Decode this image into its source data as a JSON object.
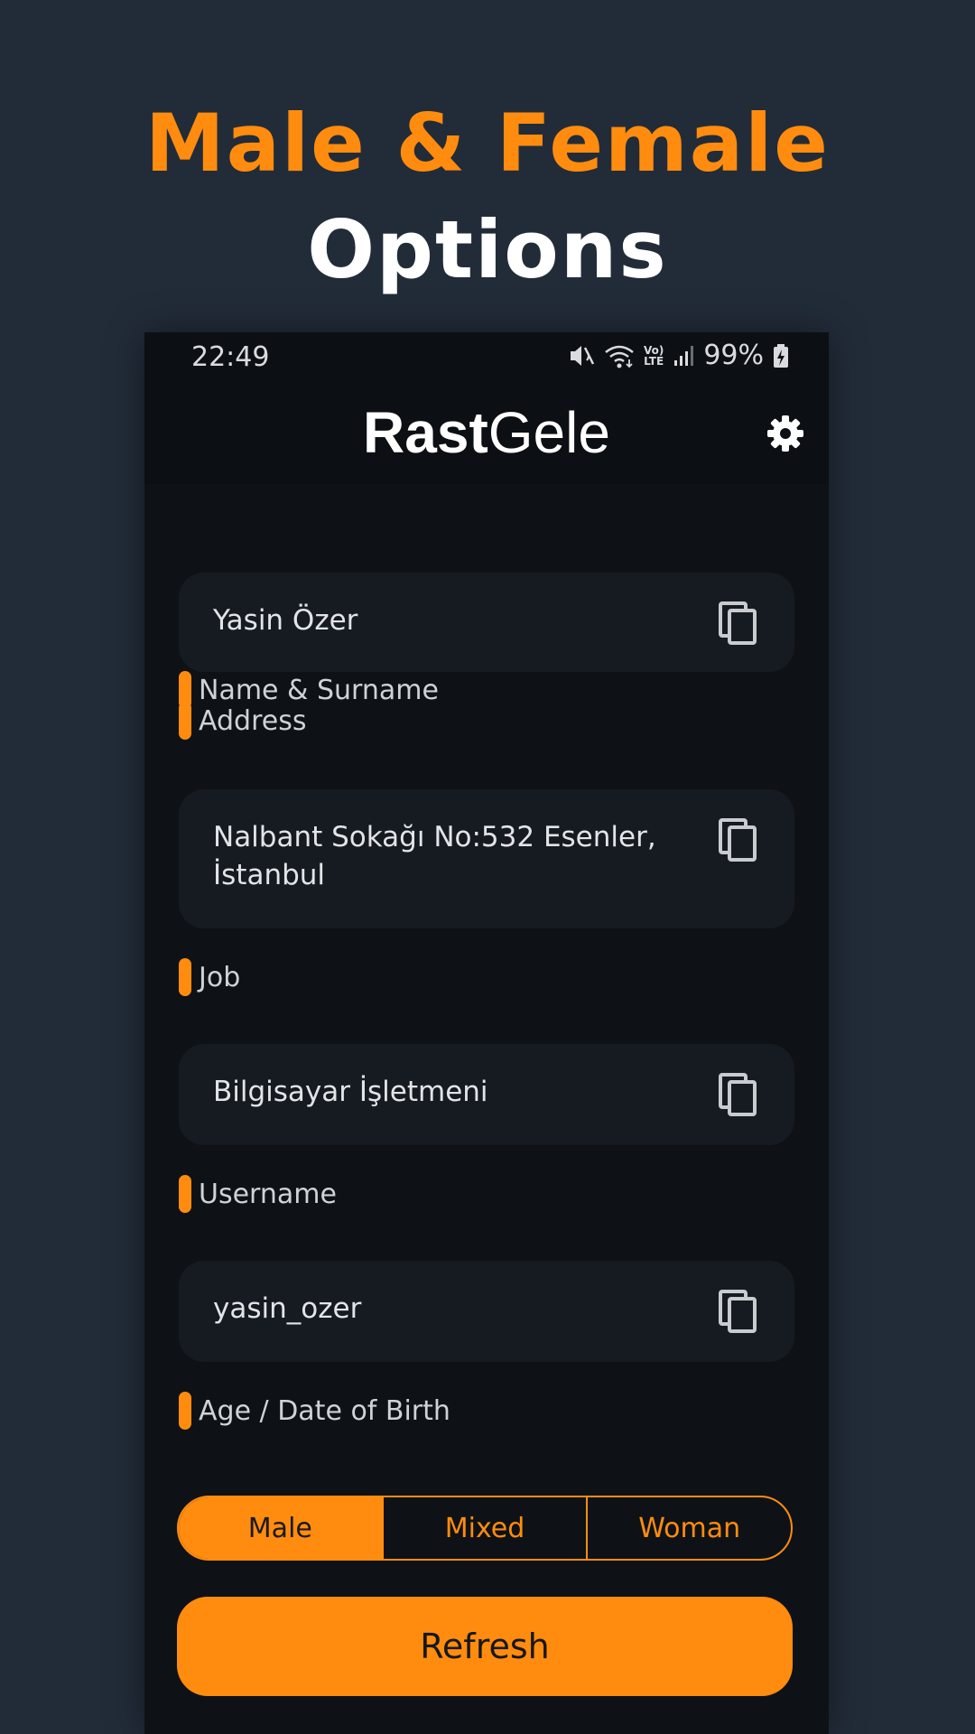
{
  "promo": {
    "line1": "Male & Female",
    "line2": "Options"
  },
  "status_bar": {
    "time": "22:49",
    "battery_percent": "99%",
    "icons": [
      "mute-icon",
      "wifi-icon",
      "volte-lte-icon",
      "signal-icon",
      "battery-charging-icon"
    ],
    "volte_label_top": "Vo)",
    "volte_label_bottom": "LTE"
  },
  "app_bar": {
    "title_bold": "Rast",
    "title_light": "Gele",
    "settings_icon": "gear-icon"
  },
  "fields": [
    {
      "label": "Name & Surname",
      "value": "Yasin Özer"
    },
    {
      "label": "Address",
      "value": "Nalbant Sokağı No:532 Esenler, İstanbul"
    },
    {
      "label": "Job",
      "value": "Bilgisayar İşletmeni"
    },
    {
      "label": "Username",
      "value": "yasin_ozer"
    },
    {
      "label": "Age / Date of Birth"
    }
  ],
  "gender_options": {
    "options": [
      "Male",
      "Mixed",
      "Woman"
    ],
    "selected": "Male"
  },
  "refresh_label": "Refresh",
  "colors": {
    "accent": "#ff8c0f",
    "background": "#222c39",
    "phone_bg": "#0e1217",
    "card_bg": "#161b21"
  }
}
